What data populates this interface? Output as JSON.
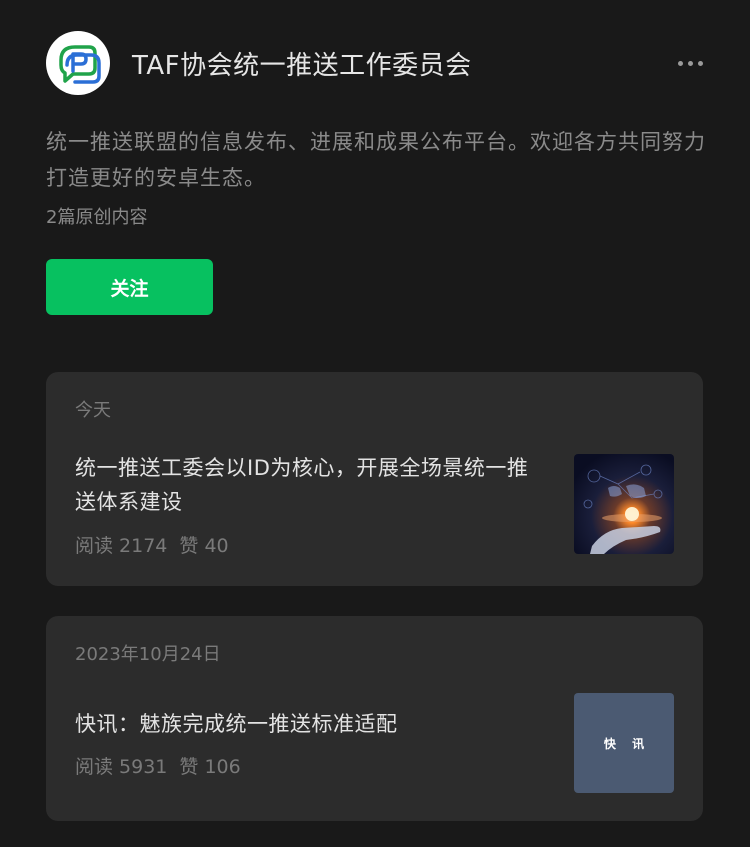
{
  "account": {
    "name": "TAF协会统一推送工作委员会",
    "logo_icon": "chat-p-logo",
    "description": "统一推送联盟的信息发布、进展和成果公布平台。欢迎各方共同努力打造更好的安卓生态。",
    "original_count": "2篇原创内容"
  },
  "follow_button": {
    "label": "关注",
    "color": "#07c160"
  },
  "articles": [
    {
      "date": "今天",
      "title": "统一推送工委会以ID为核心，开展全场景统一推送体系建设",
      "reads": "阅读 2174",
      "likes": "赞 40",
      "thumbnail": "tech-hand-globe-image"
    },
    {
      "date": "2023年10月24日",
      "title": "快讯：魅族完成统一推送标准适配",
      "reads": "阅读 5931",
      "likes": "赞 106",
      "thumbnail_label": "快 讯"
    }
  ],
  "colors": {
    "background": "#191919",
    "card": "#2c2c2c",
    "accent": "#07c160"
  }
}
